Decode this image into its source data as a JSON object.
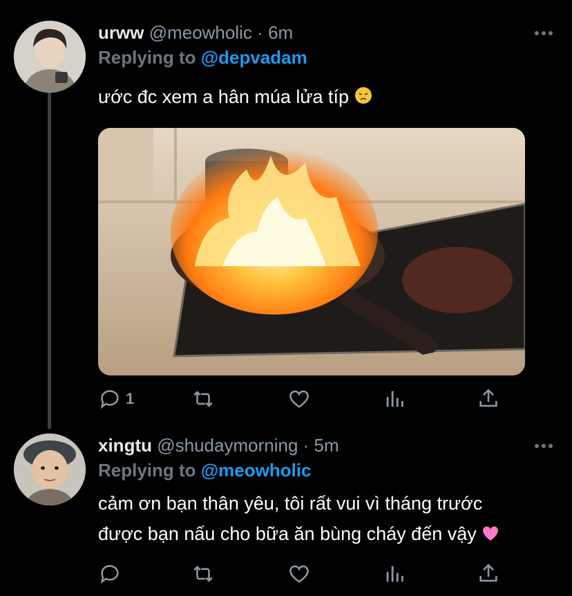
{
  "tweets": [
    {
      "name": "urww",
      "handle": "@meowholic",
      "separator": "·",
      "time": "6m",
      "replying_prefix": "Replying to",
      "replying_to": "@depvadam",
      "text": "ước đc xem a hân múa lửa típ",
      "text_emoji": "pensive-face",
      "media": "pan-on-fire-image",
      "reply_count": "1"
    },
    {
      "name": "xingtu",
      "handle": "@shudaymorning",
      "separator": "·",
      "time": "5m",
      "replying_prefix": "Replying to",
      "replying_to": "@meowholic",
      "text_line1": "cảm ơn bạn thân yêu, tôi rất vui vì tháng trước",
      "text_line2": "được bạn nấu cho bữa ăn bùng cháy đến vậy",
      "text_emoji": "pink-heart",
      "reply_count": ""
    }
  ],
  "colors": {
    "background": "#000000",
    "accent": "#1d9bf0",
    "muted": "#8b98a5",
    "thread_line": "#3a3f44"
  },
  "icons": [
    "reply-icon",
    "retweet-icon",
    "like-icon",
    "analytics-icon",
    "share-icon",
    "more-icon"
  ]
}
